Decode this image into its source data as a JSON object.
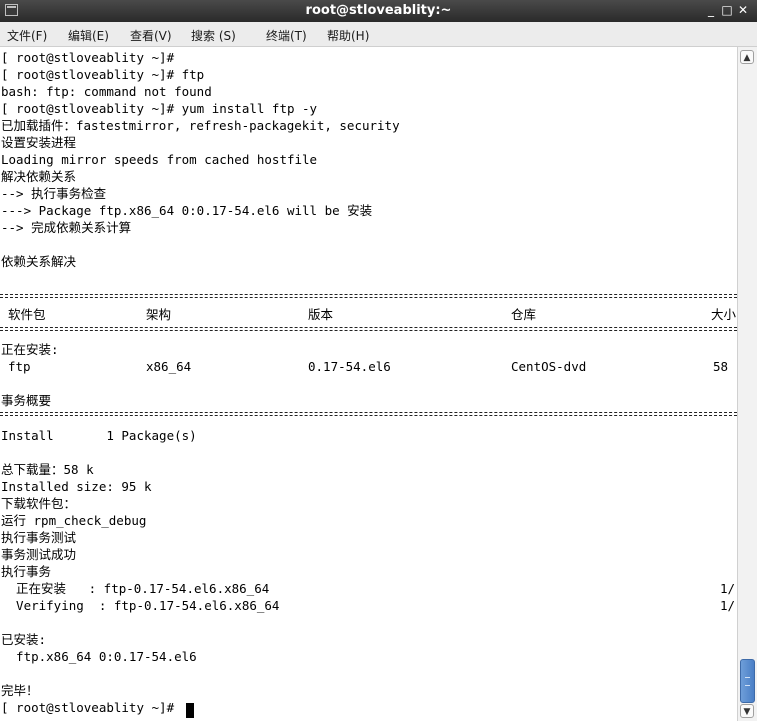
{
  "window": {
    "title": "root@stloveablity:~",
    "minimize_glyph": "_",
    "maximize_glyph": "□",
    "close_glyph": "✕"
  },
  "menu": [
    "文件(F)",
    "编辑(E)",
    "查看(V)",
    "搜索 (S)",
    "终端(T)",
    "帮助(H)"
  ],
  "terminal": {
    "lines": [
      "[ root@stloveablity ~]#",
      "[ root@stloveablity ~]# ftp",
      "bash: ftp: command not found",
      "[ root@stloveablity ~]# yum install ftp -y",
      "已加载插件：fastestmirror, refresh-packagekit, security",
      "设置安装进程",
      "Loading mirror speeds from cached hostfile",
      "解决依赖关系",
      "--> 执行事务检查",
      "---> Package ftp.x86_64 0:0.17-54.el6 will be 安装",
      "--> 完成依赖关系计算",
      "",
      "依赖关系解决"
    ],
    "table_headers": {
      "package": "软件包",
      "arch": "架构",
      "version": "版本",
      "repo": "仓库",
      "size": "大小"
    },
    "installing_label": "正在安装:",
    "package_row": {
      "package": "ftp",
      "arch": "x86_64",
      "version": "0.17-54.el6",
      "repo": "CentOS-dvd",
      "size": "58"
    },
    "summary_label": "事务概要",
    "install_summary": "Install       1 Package(s)",
    "tail_lines": [
      "总下载量：58 k",
      "Installed size: 95 k",
      "下载软件包：",
      "运行 rpm_check_debug",
      "执行事务测试",
      "事务测试成功",
      "执行事务"
    ],
    "progress_rows": [
      {
        "left": "  正在安装   : ftp-0.17-54.el6.x86_64",
        "right": "1/"
      },
      {
        "left": "  Verifying  : ftp-0.17-54.el6.x86_64",
        "right": "1/"
      }
    ],
    "installed_label": "已安装:",
    "installed_pkg": "  ftp.x86_64 0:0.17-54.el6",
    "done": "完毕！",
    "prompt": "[ root@stloveablity ~]# "
  },
  "icons": {
    "app": "terminal-icon",
    "scroll_up": "chevron-up-icon",
    "scroll_down": "chevron-down-icon"
  }
}
